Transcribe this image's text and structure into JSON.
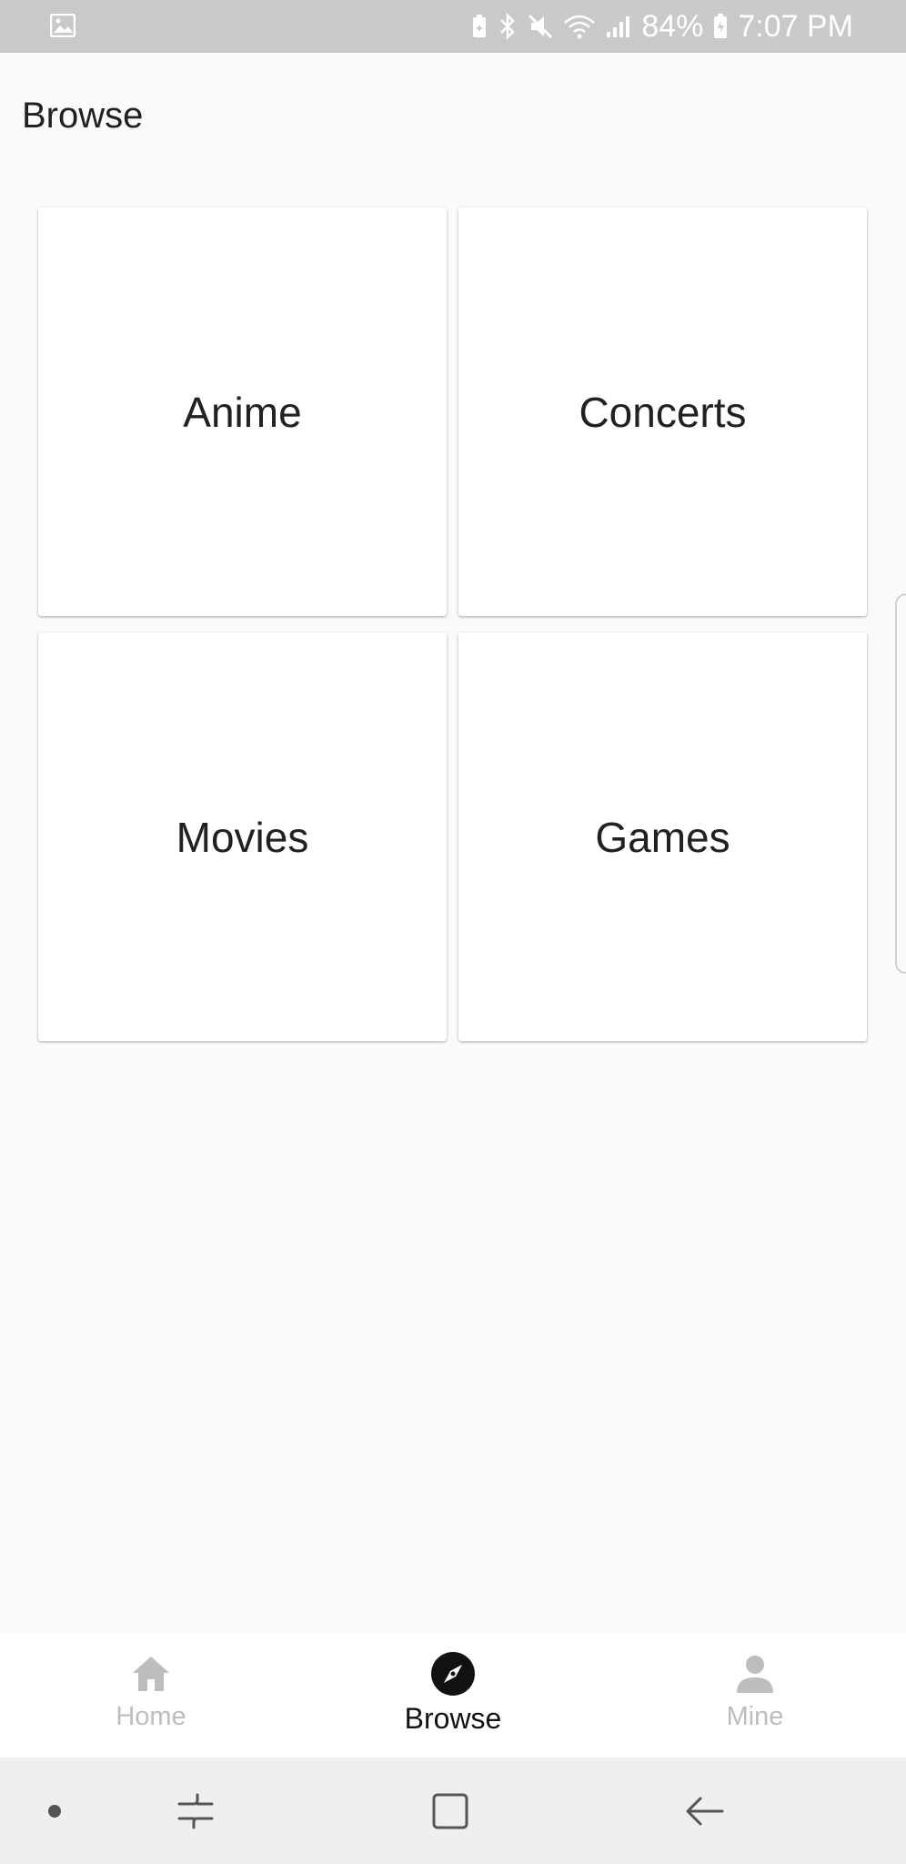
{
  "status_bar": {
    "battery_percent": "84%",
    "time": "7:07 PM",
    "icons": [
      "gallery-icon",
      "battery-saver-icon",
      "bluetooth-icon",
      "mute-icon",
      "wifi-icon",
      "signal-icon",
      "battery-charging-icon"
    ]
  },
  "header": {
    "title": "Browse"
  },
  "categories": [
    {
      "label": "Anime"
    },
    {
      "label": "Concerts"
    },
    {
      "label": "Movies"
    },
    {
      "label": "Games"
    }
  ],
  "bottom_nav": {
    "items": [
      {
        "label": "Home",
        "icon": "home-icon",
        "active": false
      },
      {
        "label": "Browse",
        "icon": "compass-icon",
        "active": true
      },
      {
        "label": "Mine",
        "icon": "person-icon",
        "active": false
      }
    ],
    "active_color": "#111111",
    "inactive_color": "#bdbdbd"
  },
  "system_nav": {
    "icons": [
      "dot-icon",
      "recents-icon",
      "home-square-icon",
      "back-icon"
    ]
  }
}
